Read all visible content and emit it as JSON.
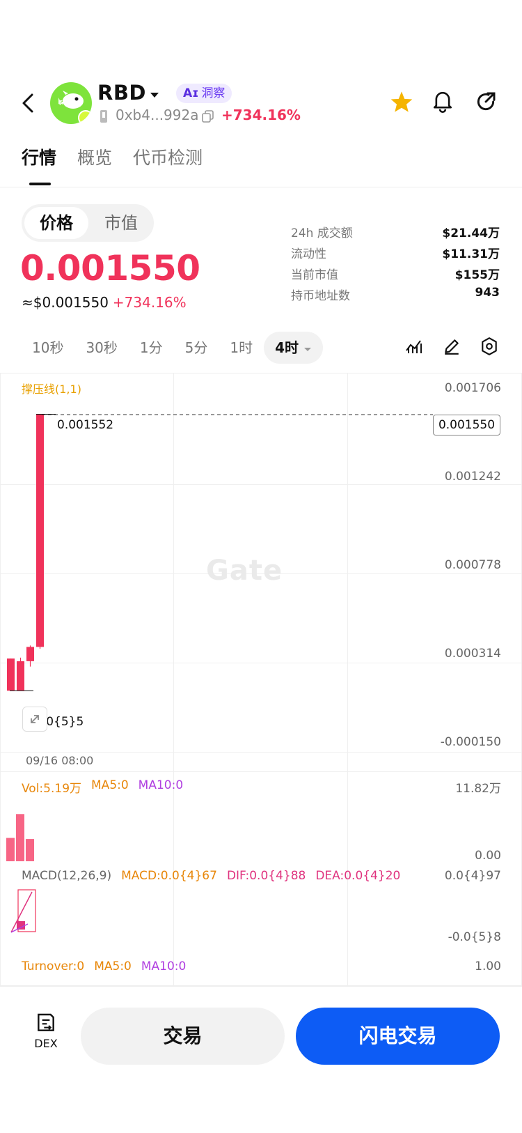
{
  "header": {
    "symbol": "RBD",
    "ai_badge_prefix": "Aɪ",
    "ai_badge_label": "洞察",
    "address": "0xb4...992a",
    "change": "+734.16%"
  },
  "tabs": [
    {
      "label": "行情",
      "active": true
    },
    {
      "label": "概览",
      "active": false
    },
    {
      "label": "代币检测",
      "active": false
    }
  ],
  "price_toggle": {
    "options": [
      "价格",
      "市值"
    ],
    "selected": "价格"
  },
  "price": {
    "value": "0.001550",
    "usd": "≈$0.001550",
    "change": "+734.16%"
  },
  "stats": [
    {
      "label": "24h 成交额",
      "value": "$21.44万"
    },
    {
      "label": "流动性",
      "value": "$11.31万"
    },
    {
      "label": "当前市值",
      "value": "$155万"
    },
    {
      "label": "持币地址数",
      "value": "943"
    }
  ],
  "intervals": [
    {
      "label": "10秒",
      "active": false
    },
    {
      "label": "30秒",
      "active": false
    },
    {
      "label": "1分",
      "active": false
    },
    {
      "label": "5分",
      "active": false
    },
    {
      "label": "1时",
      "active": false
    },
    {
      "label": "4时",
      "active": true
    }
  ],
  "chart": {
    "support_resistance_label": "撑压线(1,1)",
    "y_labels": [
      "0.001706",
      "0.001242",
      "0.000778",
      "0.000314",
      "-0.000150"
    ],
    "current_price": "0.001550",
    "high_label": "0.001552",
    "low_label": "0.0{5}5",
    "watermark": "Gate",
    "time_label": "09/16 08:00"
  },
  "chart_data": {
    "type": "candlestick",
    "ylim": [
      -0.00015,
      0.001706
    ],
    "candles": [
      {
        "open": 0.000185,
        "close": 5e-06,
        "high": 0.000185,
        "low": 5e-06,
        "color": "up"
      },
      {
        "open": 5e-06,
        "close": 0.00017,
        "high": 0.00019,
        "low": 5e-06,
        "color": "up"
      },
      {
        "open": 0.00017,
        "close": 0.00025,
        "high": 0.000258,
        "low": 0.00014,
        "color": "up"
      },
      {
        "open": 0.00025,
        "close": 0.001552,
        "high": 0.001552,
        "low": 0.00024,
        "color": "up"
      }
    ],
    "volume": {
      "label": "Vol:5.19万",
      "ma5": "MA5:0",
      "ma10": "MA10:0",
      "max_label": "11.82万",
      "min_label": "0.00",
      "values": [
        4.3,
        8.7,
        4.1
      ]
    },
    "macd": {
      "label": "MACD(12,26,9)",
      "macd": "MACD:0.0{4}67",
      "dif": "DIF:0.0{4}88",
      "dea": "DEA:0.0{4}20",
      "max_label": "0.0{4}97",
      "min_label": "-0.0{5}8"
    },
    "turnover": {
      "label": "Turnover:0",
      "ma5": "MA5:0",
      "ma10": "MA10:0",
      "max_label": "1.00"
    }
  },
  "bottom": {
    "dex_label": "DEX",
    "trade_label": "交易",
    "flash_label": "闪电交易"
  },
  "colors": {
    "up": "#f0325a",
    "primary": "#0d5cf5"
  }
}
